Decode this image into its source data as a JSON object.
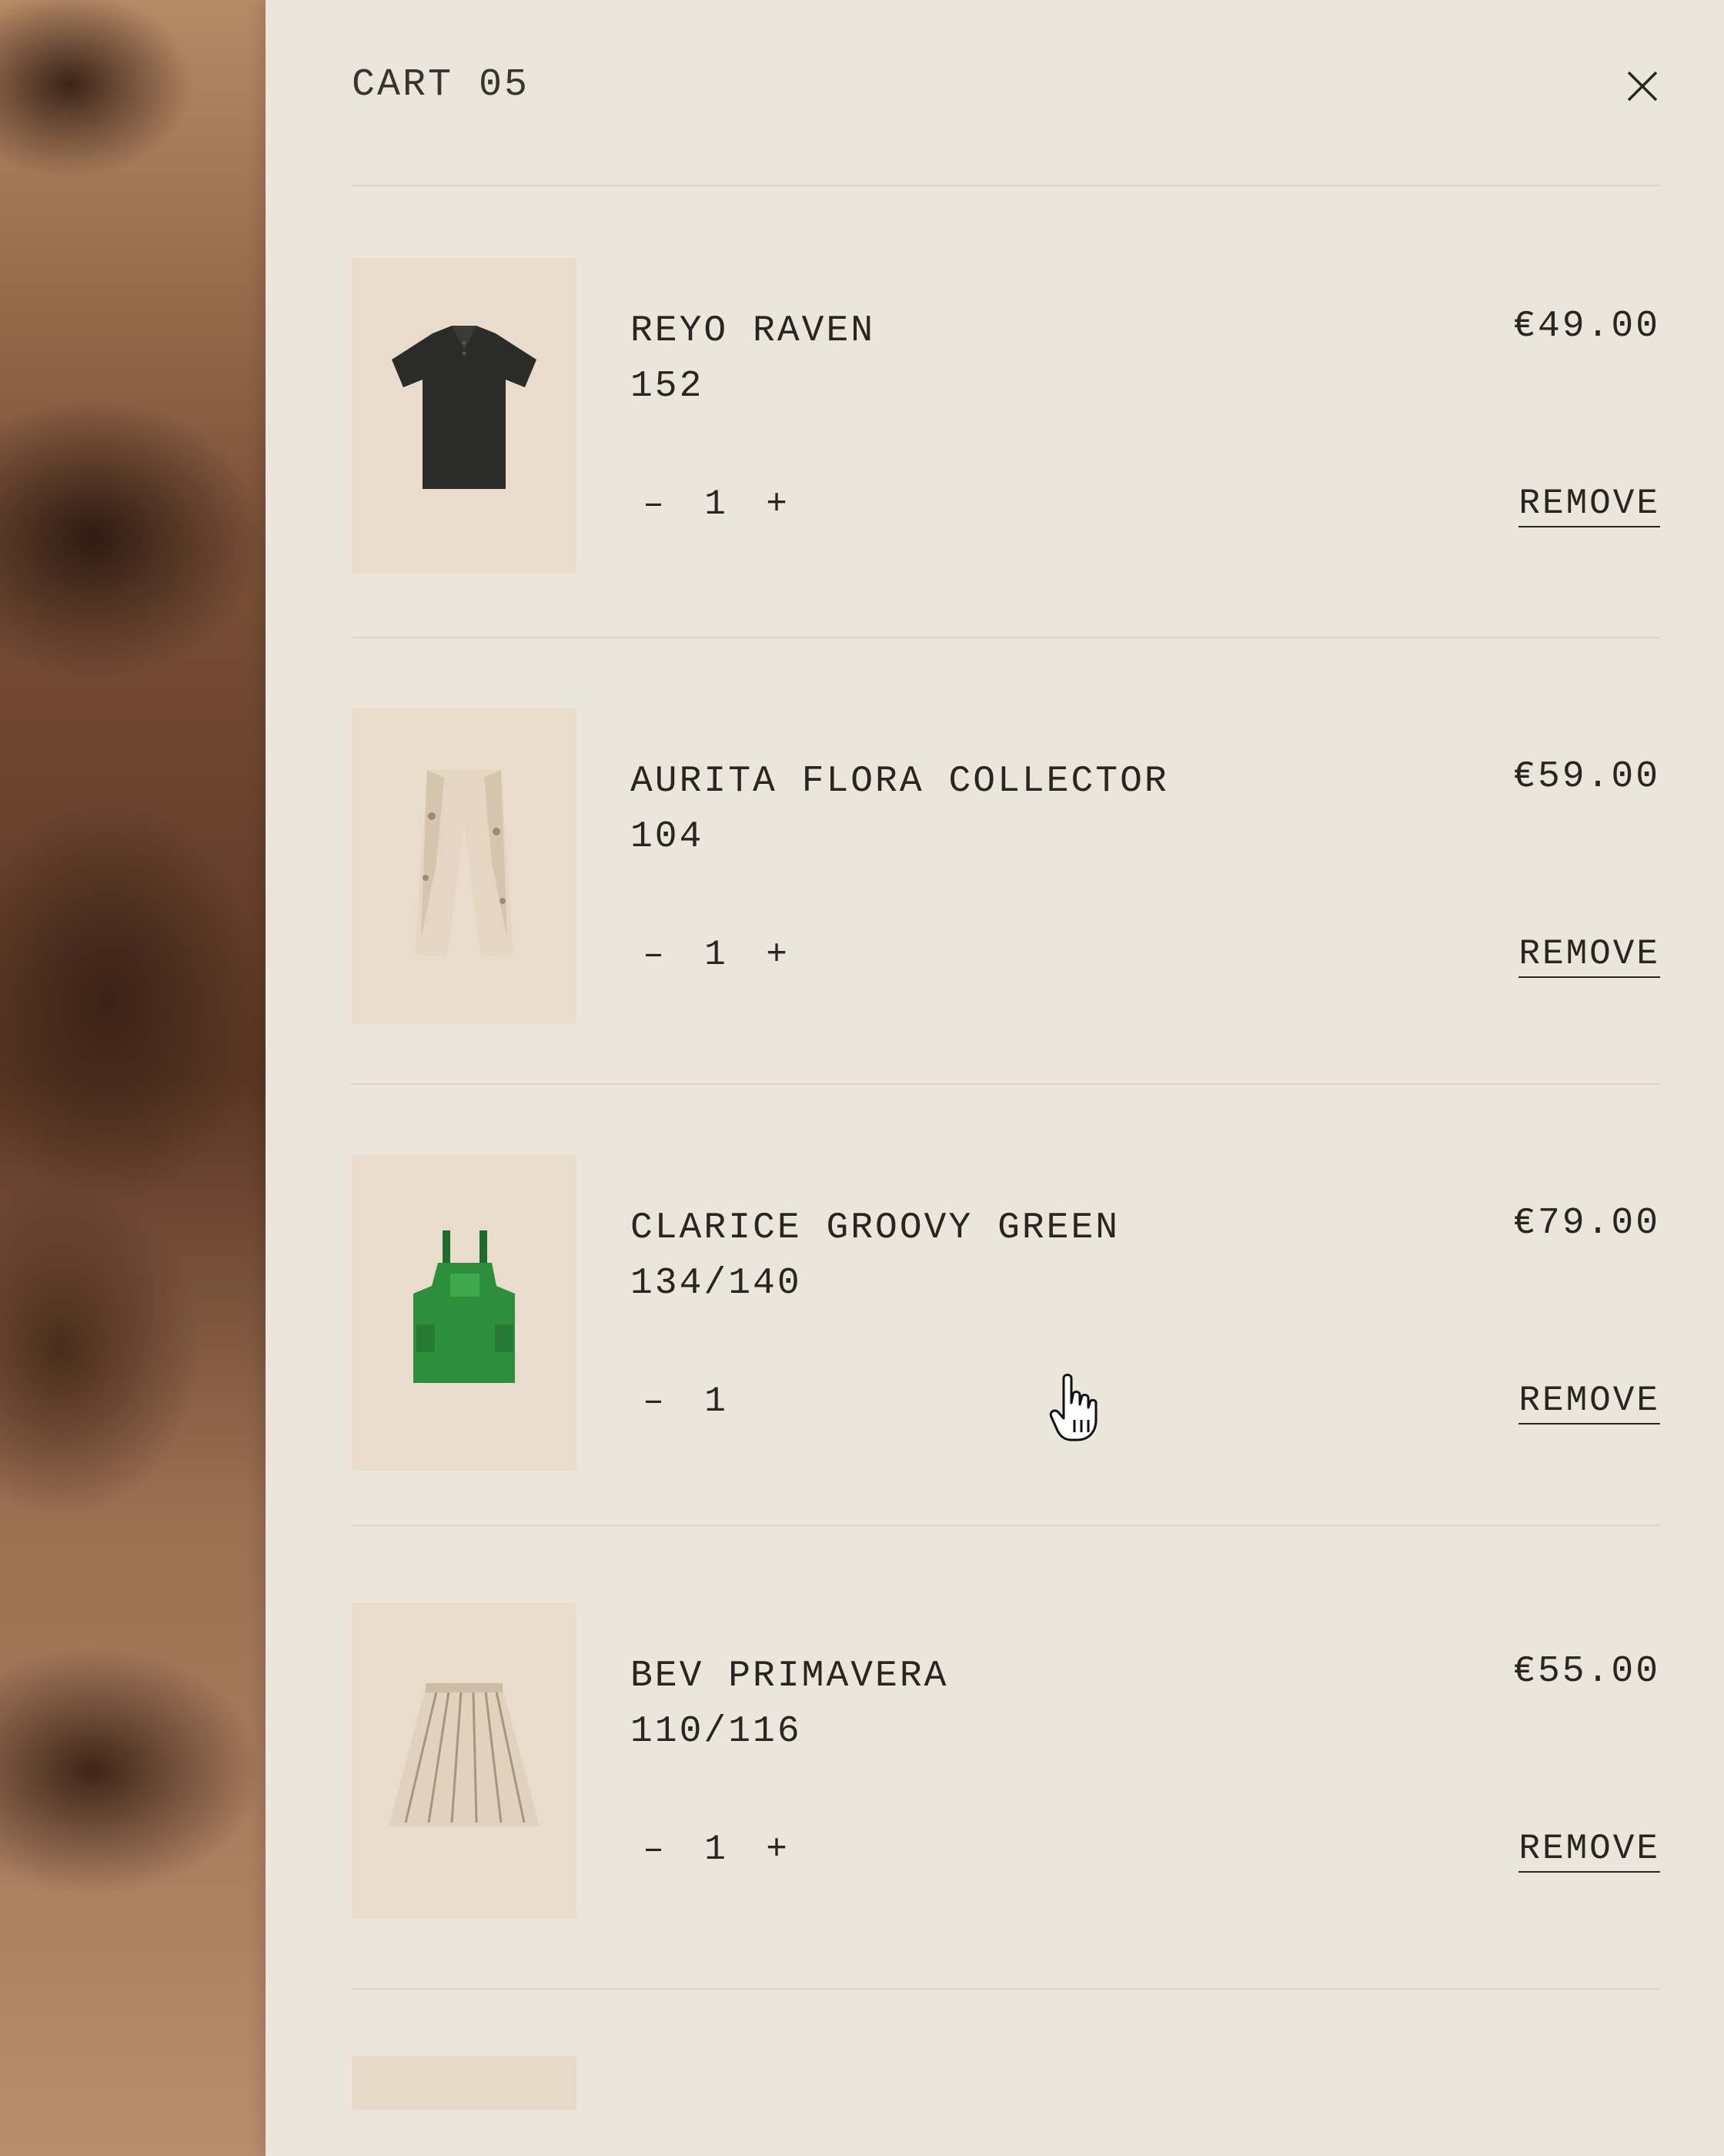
{
  "cart": {
    "title": "CART 05",
    "close_icon": "close-icon"
  },
  "items": [
    {
      "name": "REYO RAVEN",
      "size": "152",
      "price": "€49.00",
      "qty": "1",
      "minus": "–",
      "plus": "+",
      "remove": "REMOVE",
      "image": "black-polo-shirt"
    },
    {
      "name": "AURITA FLORA COLLECTOR",
      "size": "104",
      "price": "€59.00",
      "qty": "1",
      "minus": "–",
      "plus": "+",
      "remove": "REMOVE",
      "image": "beige-floral-trousers"
    },
    {
      "name": "CLARICE GROOVY GREEN",
      "size": "134/140",
      "price": "€79.00",
      "qty": "1",
      "minus": "–",
      "plus": "+",
      "remove": "REMOVE",
      "image": "green-dungarees"
    },
    {
      "name": "BEV PRIMAVERA",
      "size": "110/116",
      "price": "€55.00",
      "qty": "1",
      "minus": "–",
      "plus": "+",
      "remove": "REMOVE",
      "image": "printed-skirt"
    }
  ],
  "colors": {
    "panel_bg": "#ece5dc",
    "thumb_bg": "#e9dccd",
    "text": "#2a2522"
  }
}
